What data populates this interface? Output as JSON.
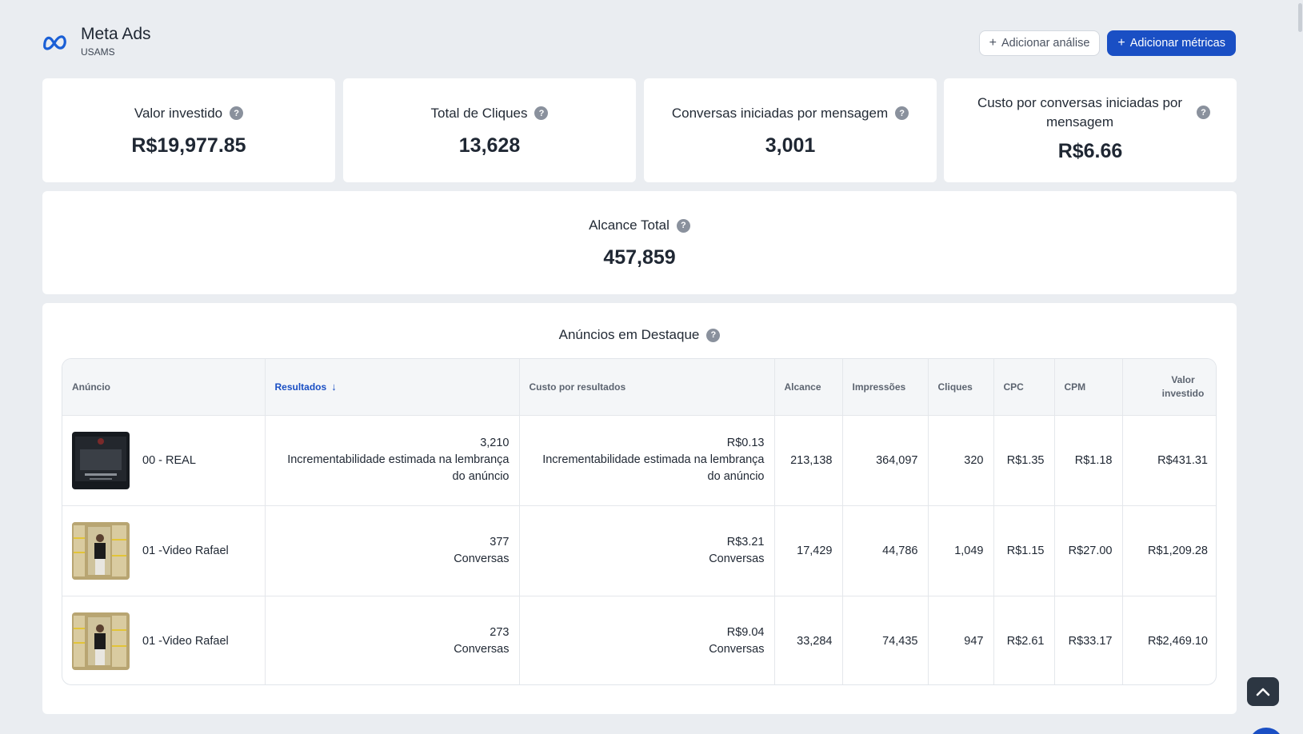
{
  "header": {
    "title": "Meta Ads",
    "subtitle": "USAMS",
    "add_analysis_label": "Adicionar análise",
    "add_metrics_label": "Adicionar métricas"
  },
  "kpis": {
    "invested": {
      "label": "Valor investido",
      "value": "R$19,977.85"
    },
    "clicks": {
      "label": "Total de Cliques",
      "value": "13,628"
    },
    "conversations": {
      "label": "Conversas iniciadas por mensagem",
      "value": "3,001"
    },
    "cost_per_conversation": {
      "label": "Custo por conversas iniciadas por mensagem",
      "value": "R$6.66"
    },
    "reach": {
      "label": "Alcance Total",
      "value": "457,859"
    }
  },
  "featured": {
    "title": "Anúncios em Destaque",
    "columns": {
      "ad": "Anúncio",
      "results": "Resultados",
      "cost_per_result": "Custo por resultados",
      "reach": "Alcance",
      "impressions": "Impressões",
      "clicks": "Cliques",
      "cpc": "CPC",
      "cpm": "CPM",
      "invested": "Valor investido"
    },
    "rows": [
      {
        "name": "00 - REAL",
        "results_value": "3,210",
        "results_type": "Incrementabilidade estimada na lembrança do anúncio",
        "cost_value": "R$0.13",
        "cost_type": "Incrementabilidade estimada na lembrança do anúncio",
        "reach": "213,138",
        "impressions": "364,097",
        "clicks": "320",
        "cpc": "R$1.35",
        "cpm": "R$1.18",
        "invested": "R$431.31"
      },
      {
        "name": "01 -Video Rafael",
        "results_value": "377",
        "results_type": "Conversas",
        "cost_value": "R$3.21",
        "cost_type": "Conversas",
        "reach": "17,429",
        "impressions": "44,786",
        "clicks": "1,049",
        "cpc": "R$1.15",
        "cpm": "R$27.00",
        "invested": "R$1,209.28"
      },
      {
        "name": "01 -Video Rafael",
        "results_value": "273",
        "results_type": "Conversas",
        "cost_value": "R$9.04",
        "cost_type": "Conversas",
        "reach": "33,284",
        "impressions": "74,435",
        "clicks": "947",
        "cpc": "R$2.61",
        "cpm": "R$33.17",
        "invested": "R$2,469.10"
      }
    ]
  },
  "colors": {
    "accent": "#1a4fc4",
    "background": "#eaedf1",
    "card": "#ffffff"
  },
  "icons": [
    "meta-logo-icon",
    "plus-icon",
    "help-icon",
    "arrow-down-icon",
    "chevron-up-icon"
  ]
}
